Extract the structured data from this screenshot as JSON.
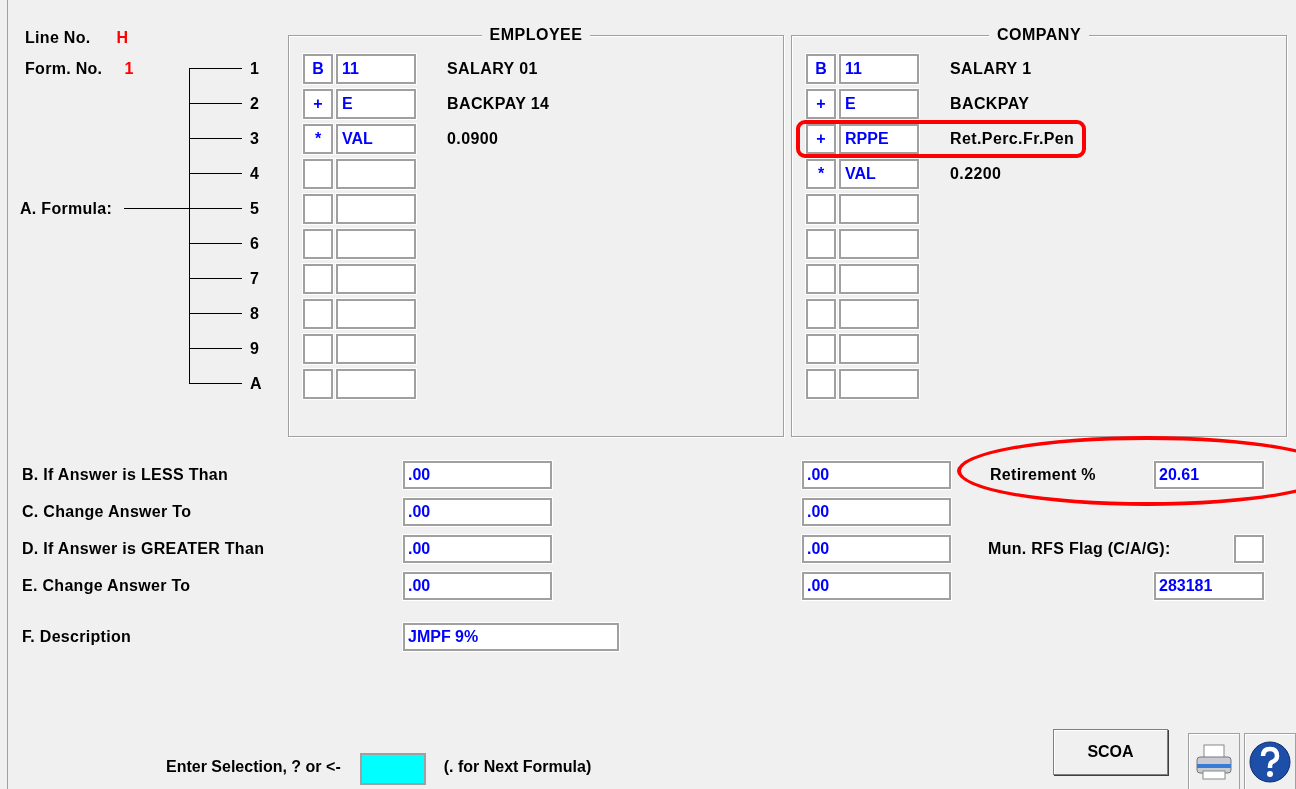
{
  "header": {
    "line_no_label": "Line No.",
    "line_no": "H",
    "form_no_label": "Form. No.",
    "form_no": "1"
  },
  "formula_label": "A. Formula:",
  "formula_steps": [
    "1",
    "2",
    "3",
    "4",
    "5",
    "6",
    "7",
    "8",
    "9",
    "A"
  ],
  "groups": [
    {
      "title": "EMPLOYEE",
      "rows": [
        {
          "op": "B",
          "code": "11",
          "description": "SALARY 01",
          "highlighted": false
        },
        {
          "op": "+",
          "code": "E",
          "description": "BACKPAY 14",
          "highlighted": false
        },
        {
          "op": "*",
          "code": "VAL",
          "description": "0.0900",
          "highlighted": false
        },
        {
          "highlighted": false
        },
        {
          "highlighted": false
        },
        {
          "highlighted": false
        },
        {
          "highlighted": false
        },
        {
          "highlighted": false
        },
        {
          "highlighted": false
        },
        {
          "highlighted": false
        }
      ]
    },
    {
      "title": "COMPANY",
      "rows": [
        {
          "op": "B",
          "code": "11",
          "description": "SALARY 1",
          "highlighted": false
        },
        {
          "op": "+",
          "code": "E",
          "description": "BACKPAY",
          "highlighted": false
        },
        {
          "op": "+",
          "code": "RPPE",
          "description": "Ret.Perc.Fr.Pen",
          "highlighted": true
        },
        {
          "op": "*",
          "code": "VAL",
          "description": "0.2200",
          "highlighted": false
        },
        {
          "highlighted": false
        },
        {
          "highlighted": false
        },
        {
          "highlighted": false
        },
        {
          "highlighted": false
        },
        {
          "highlighted": false
        },
        {
          "highlighted": false
        }
      ]
    }
  ],
  "limits": [
    {
      "label": "B. If Answer is LESS Than",
      "employee": ".00",
      "company": ".00"
    },
    {
      "label": "C. Change Answer To",
      "employee": ".00",
      "company": ".00"
    },
    {
      "label": "D. If Answer is GREATER Than",
      "employee": ".00",
      "company": ".00"
    },
    {
      "label": "E. Change Answer To",
      "employee": ".00",
      "company": ".00"
    }
  ],
  "retirement": {
    "label": "Retirement %",
    "value": "20.61",
    "highlighted": true
  },
  "mun_rfs": {
    "label": "Mun. RFS Flag (C/A/G):"
  },
  "code_field": {
    "value": "283181"
  },
  "description": {
    "label": "F. Description",
    "value": "JMPF 9%"
  },
  "selection": {
    "prompt": "Enter Selection, ? or <-",
    "hint": "(. for Next Formula)"
  },
  "scoa_button": "SCOA"
}
